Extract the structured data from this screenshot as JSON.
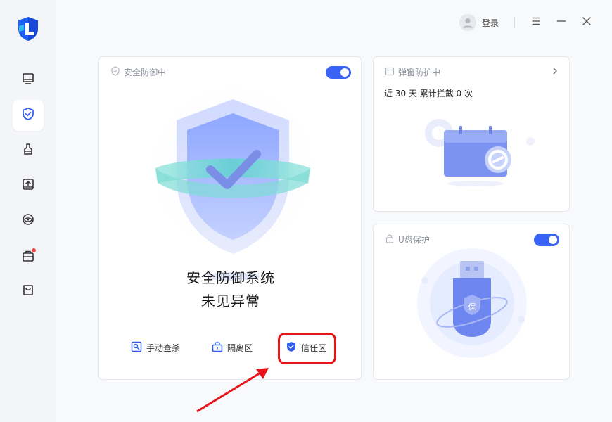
{
  "topbar": {
    "login_label": "登录",
    "icons": [
      "user-icon",
      "menu-icon",
      "minimize-icon",
      "close-icon"
    ]
  },
  "sidebar": {
    "items": [
      {
        "name": "computer",
        "icon": "monitor-icon",
        "active": false
      },
      {
        "name": "protection",
        "icon": "shield-check-icon",
        "active": true
      },
      {
        "name": "cleanup",
        "icon": "broom-icon",
        "active": false
      },
      {
        "name": "drive",
        "icon": "drive-icon",
        "active": false
      },
      {
        "name": "privacy",
        "icon": "privacy-eye-icon",
        "active": false
      },
      {
        "name": "toolbox",
        "icon": "toolbox-icon",
        "active": false,
        "badge": true
      },
      {
        "name": "store",
        "icon": "bag-icon",
        "active": false
      }
    ]
  },
  "defense_card": {
    "title": "安全防御中",
    "toggle_on": true,
    "status_line1": "安全防御系统",
    "status_line2": "未见异常",
    "actions": [
      {
        "label": "手动查杀",
        "icon": "manual-scan-icon"
      },
      {
        "label": "隔离区",
        "icon": "quarantine-icon"
      },
      {
        "label": "信任区",
        "icon": "trust-zone-icon"
      }
    ]
  },
  "popup_card": {
    "title": "弹窗防护中",
    "stat": "近 30 天 累计拦截 0 次"
  },
  "usb_card": {
    "title": "U盘保护",
    "toggle_on": true,
    "usb_badge": "保"
  },
  "colors": {
    "accent": "#3a63f5",
    "annotation_red": "#e8141c",
    "sidebar_bg": "#f4f5f8",
    "main_bg": "#f8f9fb"
  }
}
